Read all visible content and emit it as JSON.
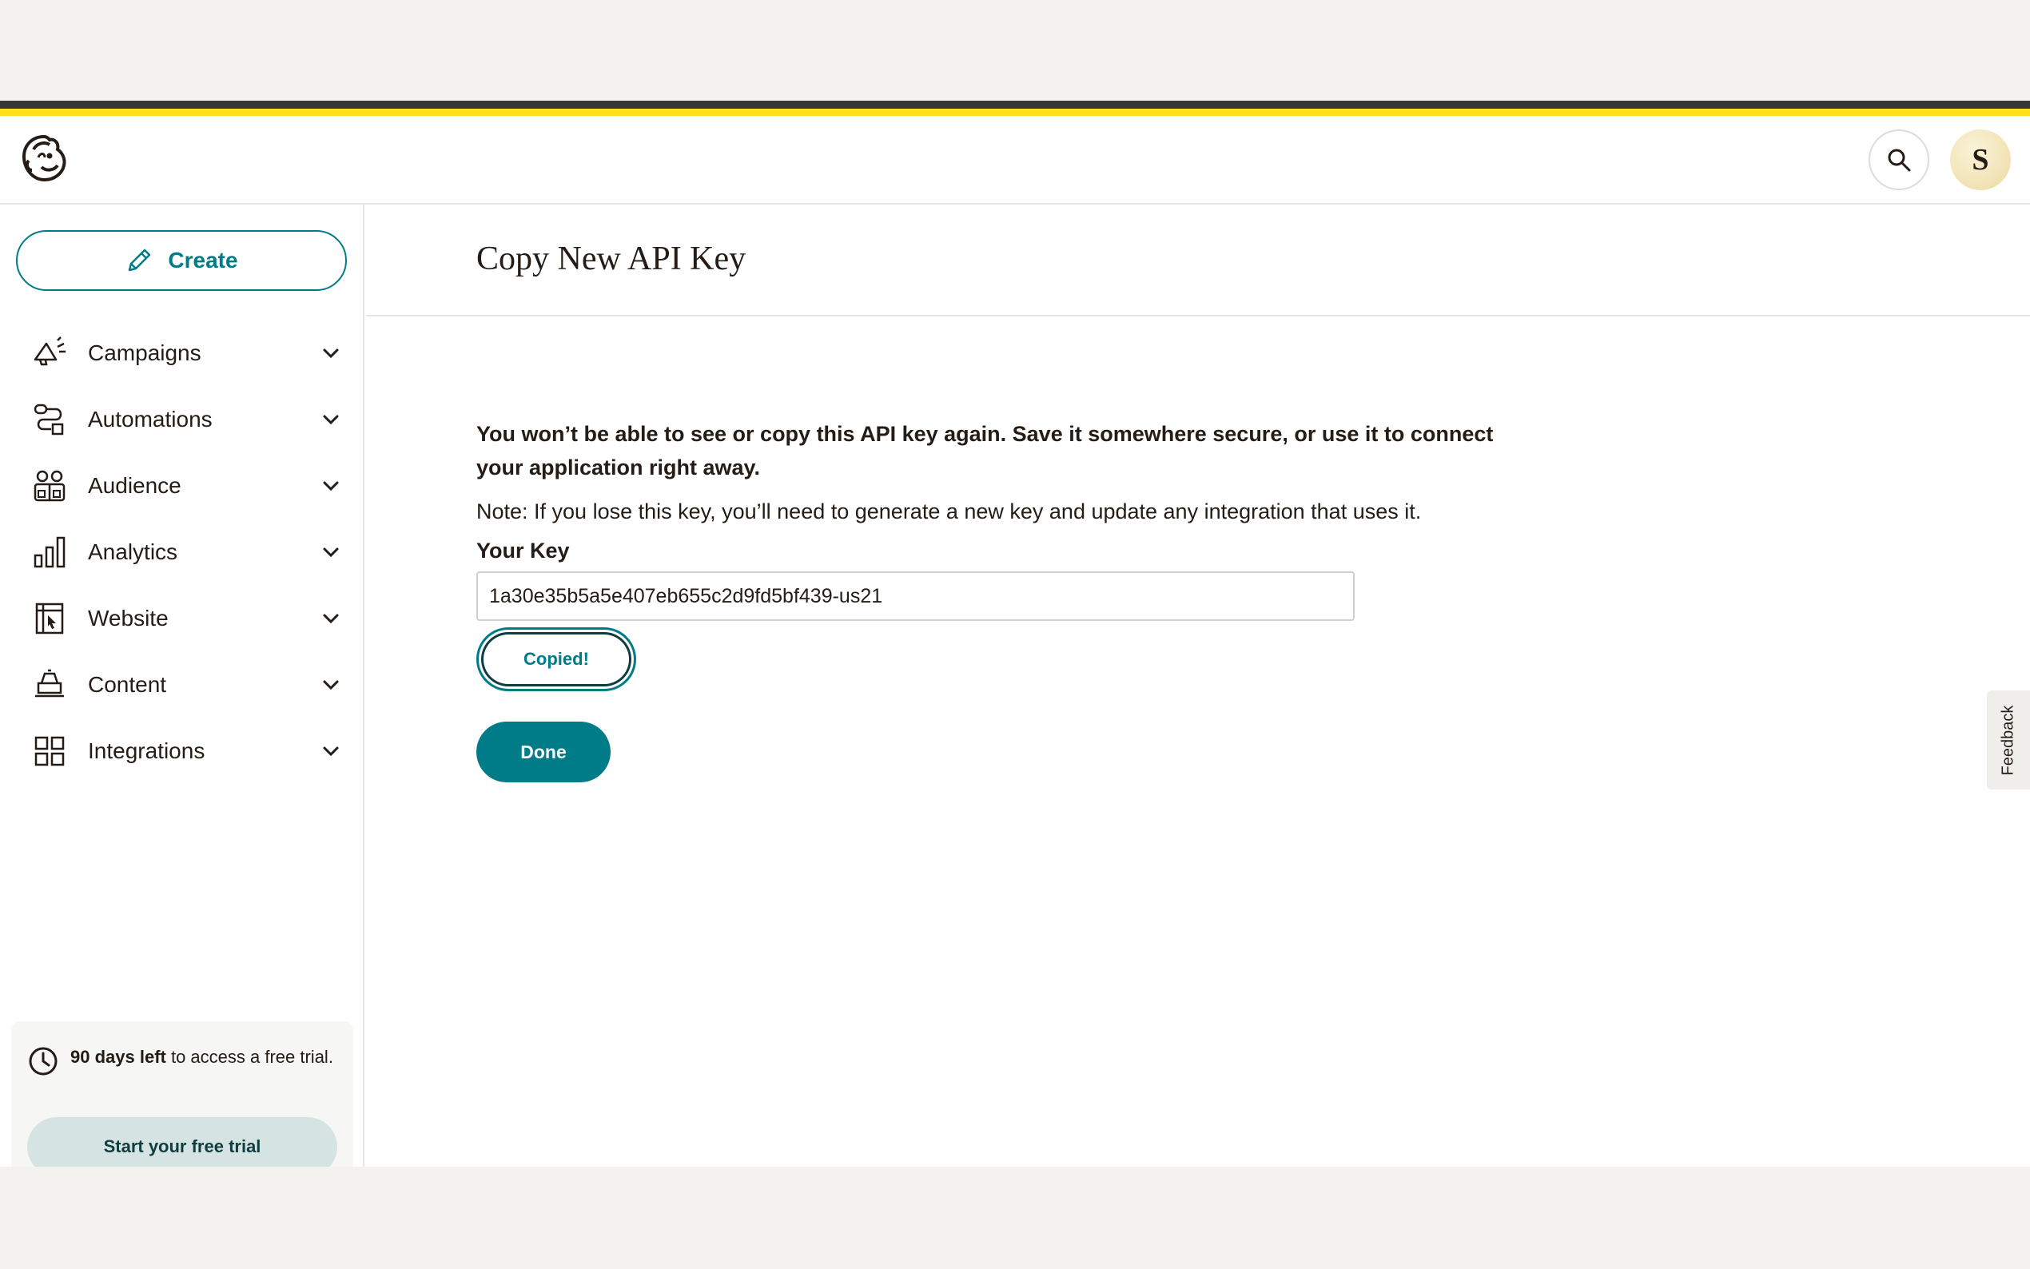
{
  "app": {
    "brand": "Mailchimp",
    "colors": {
      "accent": "#007c89",
      "brand_yellow": "#ffe01b",
      "text": "#241c15"
    }
  },
  "header": {
    "search_icon": "search-icon",
    "avatar_initial": "S"
  },
  "sidebar": {
    "create_label": "Create",
    "items": [
      {
        "label": "Campaigns",
        "icon": "megaphone-icon"
      },
      {
        "label": "Automations",
        "icon": "automation-flow-icon"
      },
      {
        "label": "Audience",
        "icon": "audience-icon"
      },
      {
        "label": "Analytics",
        "icon": "bar-chart-icon"
      },
      {
        "label": "Website",
        "icon": "website-icon"
      },
      {
        "label": "Content",
        "icon": "content-icon"
      },
      {
        "label": "Integrations",
        "icon": "grid-icon"
      }
    ],
    "trial": {
      "days_bold": "90 days left",
      "rest": " to access a free trial.",
      "button_label": "Start your free trial"
    }
  },
  "main": {
    "title": "Copy New API Key",
    "warning": "You won’t be able to see or copy this API key again. Save it somewhere secure, or use it to connect your application right away.",
    "note": "Note: If you lose this key, you’ll need to generate a new key and update any integration that uses it.",
    "key_label": "Your Key",
    "key_value": "1a30e35b5a5e407eb655c2d9fd5bf439-us21",
    "copied_label": "Copied!",
    "done_label": "Done"
  },
  "feedback_label": "Feedback",
  "help_label": "?"
}
